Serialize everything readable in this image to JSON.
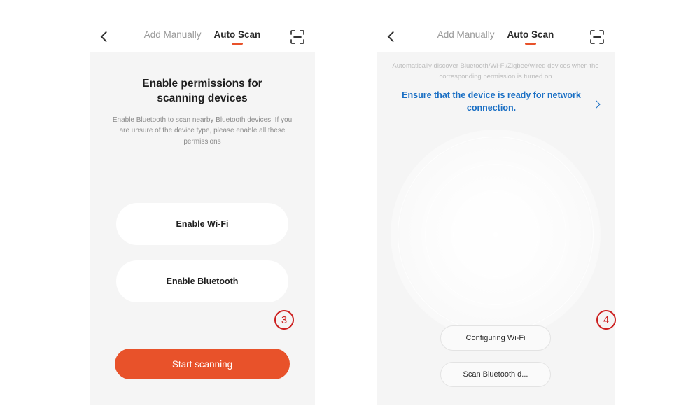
{
  "header": {
    "back_icon": "chevron-left-icon",
    "scan_icon": "scan-frame-icon",
    "tabs": [
      {
        "label": "Add Manually",
        "active": false
      },
      {
        "label": "Auto Scan",
        "active": true
      }
    ],
    "active_indicator_color": "#e8522a"
  },
  "panel_permissions": {
    "title": "Enable permissions for scanning devices",
    "description": "Enable Bluetooth to scan nearby Bluetooth devices. If you are unsure of the device type, please enable all these permissions",
    "buttons": [
      {
        "label": "Enable Wi-Fi"
      },
      {
        "label": "Enable Bluetooth"
      }
    ],
    "cta_label": "Start scanning",
    "cta_color": "#e8522a",
    "step_marker": "3"
  },
  "panel_scanning": {
    "description": "Automatically discover Bluetooth/Wi-Fi/Zigbee/wired devices when the corresponding permission is turned on",
    "link_text": "Ensure that the device is ready for network connection.",
    "link_color": "#1a6fc4",
    "link_chevron_icon": "chevron-right-icon",
    "radar_icon": "radar-pulse-graphic",
    "buttons": [
      {
        "label": "Configuring Wi-Fi"
      },
      {
        "label": "Scan Bluetooth d..."
      }
    ],
    "step_marker": "4"
  },
  "theme": {
    "page_background": "#ffffff",
    "panel_background": "#f5f5f5",
    "header_background": "#ffffff",
    "marker_color": "#cc1f1f"
  }
}
